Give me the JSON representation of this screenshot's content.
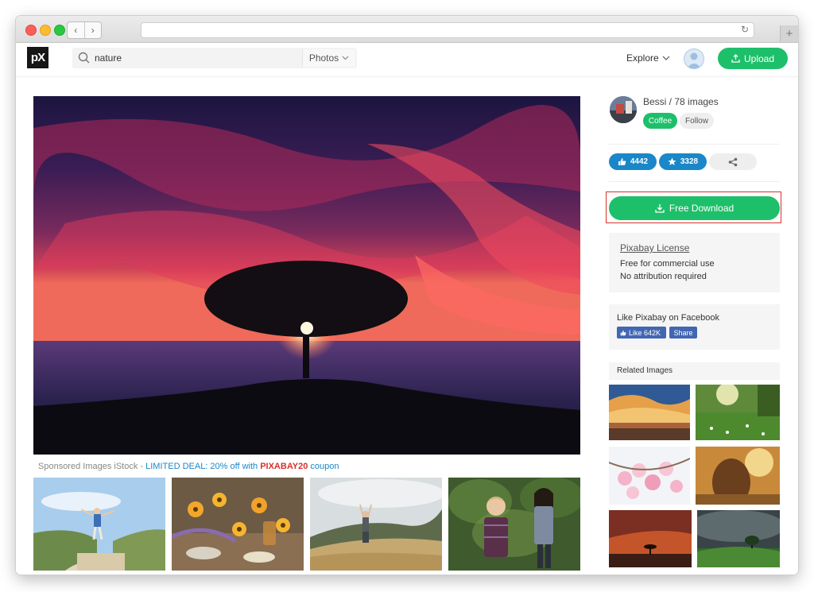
{
  "browser": {
    "nav_back": "‹",
    "nav_forward": "›",
    "url": "",
    "newtab": "+"
  },
  "header": {
    "logo": "pX",
    "search_value": "nature",
    "search_filter": "Photos",
    "explore": "Explore",
    "upload": "Upload"
  },
  "sponsored": {
    "prefix": "Sponsored Images iStock - ",
    "deal": "LIMITED DEAL: 20% off with ",
    "code": "PIXABAY20",
    "suffix": " coupon"
  },
  "author": {
    "name": "Bessi / 78 images",
    "coffee": "Coffee",
    "follow": "Follow"
  },
  "stats": {
    "likes": "4442",
    "favorites": "3328"
  },
  "download": {
    "label": "Free Download"
  },
  "license": {
    "title": "Pixabay License",
    "line1": "Free for commercial use",
    "line2": "No attribution required"
  },
  "facebook": {
    "title": "Like Pixabay on Facebook",
    "like": "Like 642K",
    "share": "Share"
  },
  "related": {
    "title": "Related Images"
  },
  "colors": {
    "accent_green": "#1ebf6a",
    "accent_blue": "#1a87c8",
    "highlight_red": "#d5342b",
    "facebook_blue": "#4267b2"
  }
}
